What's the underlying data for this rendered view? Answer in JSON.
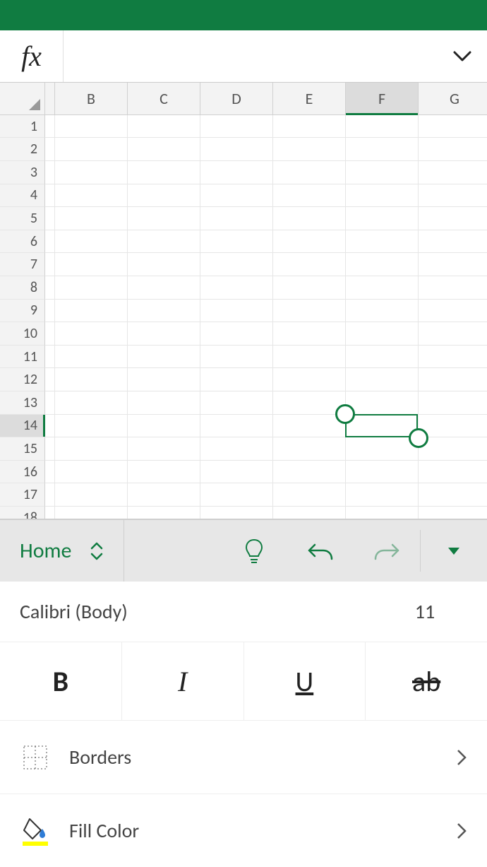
{
  "app": {
    "brand_color": "#107C41"
  },
  "formula_bar": {
    "fx_label": "fx",
    "value": "",
    "placeholder": ""
  },
  "grid": {
    "columns": [
      "",
      "B",
      "C",
      "D",
      "E",
      "F",
      "G"
    ],
    "selected_column": "F",
    "rows": [
      1,
      2,
      3,
      4,
      5,
      6,
      7,
      8,
      9,
      10,
      11,
      12,
      13,
      14,
      15,
      16,
      17,
      18
    ],
    "selected_row": 14,
    "selection": {
      "col": "F",
      "row": 14
    }
  },
  "ribbon": {
    "active_tab": "Home",
    "icons": {
      "tell_me": "lightbulb-icon",
      "undo": "undo-icon",
      "redo": "redo-icon",
      "menu": "caret-down-icon"
    }
  },
  "format": {
    "font_name": "Calibri (Body)",
    "font_size": "11",
    "buttons": {
      "bold": "B",
      "italic": "I",
      "underline": "U",
      "strikethrough": "ab"
    },
    "borders_label": "Borders",
    "fill_color_label": "Fill Color",
    "fill_swatch": "#ffff00"
  }
}
